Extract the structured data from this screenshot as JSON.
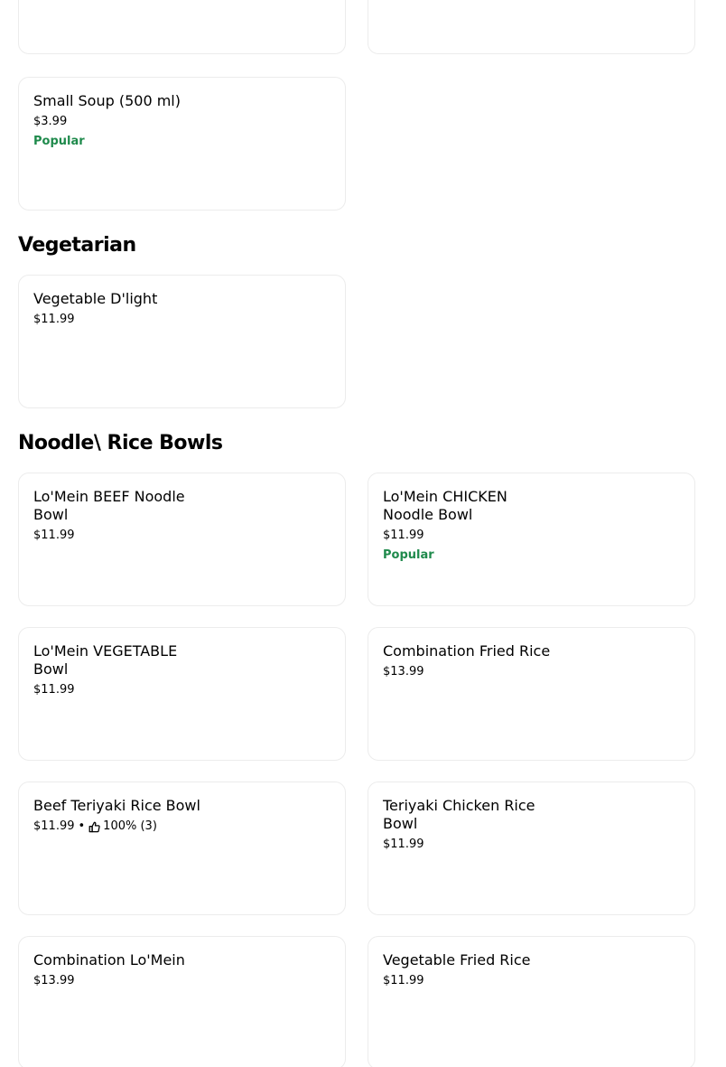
{
  "sections": [
    {
      "title": "Vegetarian",
      "items": [
        {
          "name": "Vegetable D'light",
          "price": "$11.99"
        }
      ]
    },
    {
      "title": "Noodle\\ Rice Bowls",
      "items": [
        {
          "name": "Lo'Mein BEEF  Noodle Bowl",
          "price": "$11.99"
        },
        {
          "name": "Lo'Mein CHICKEN Noodle Bowl",
          "price": "$11.99",
          "badge": "Popular"
        },
        {
          "name": "Lo'Mein VEGETABLE Bowl",
          "price": "$11.99"
        },
        {
          "name": "Combination Fried Rice",
          "price": "$13.99"
        },
        {
          "name": "Beef Teriyaki Rice Bowl",
          "price": "$11.99",
          "separator": "•",
          "rating": "100% (3)"
        },
        {
          "name": "Teriyaki Chicken Rice Bowl",
          "price": "$11.99"
        },
        {
          "name": "Combination Lo'Mein",
          "price": "$13.99"
        },
        {
          "name": "Vegetable Fried Rice",
          "price": "$11.99"
        }
      ]
    }
  ],
  "previous_section_items": [
    {
      "name": "Small Soup (500 ml)",
      "price": "$3.99",
      "badge": "Popular"
    }
  ],
  "icons": {
    "rating": "thumbs-up-icon"
  },
  "colors": {
    "popular": "#1f8a4c",
    "card_border": "#ececec"
  }
}
